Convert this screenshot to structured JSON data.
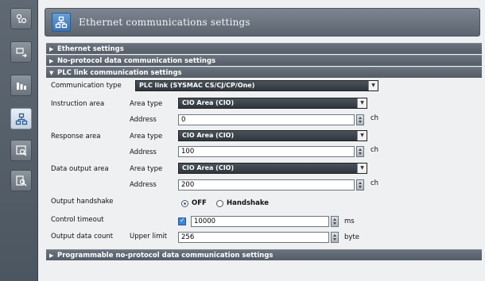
{
  "title": "Ethernet communications settings",
  "sections": {
    "ethernet": "Ethernet settings",
    "no_protocol": "No-protocol data communication settings",
    "plc_link": "PLC link communication settings",
    "programmable": "Programmable no-protocol data communication settings"
  },
  "communication_type": {
    "label": "Communication type",
    "value": "PLC link (SYSMAC CS/CJ/CP/One)"
  },
  "instruction_area": {
    "label": "Instruction area",
    "area_type_label": "Area type",
    "area_type_value": "CIO Area (CIO)",
    "address_label": "Address",
    "address_value": "0",
    "unit": "ch"
  },
  "response_area": {
    "label": "Response area",
    "area_type_label": "Area type",
    "area_type_value": "CIO Area (CIO)",
    "address_label": "Address",
    "address_value": "100",
    "unit": "ch"
  },
  "data_output_area": {
    "label": "Data output area",
    "area_type_label": "Area type",
    "area_type_value": "CIO Area (CIO)",
    "address_label": "Address",
    "address_value": "200",
    "unit": "ch"
  },
  "output_handshake": {
    "label": "Output handshake",
    "off_label": "OFF",
    "handshake_label": "Handshake",
    "selected": "OFF"
  },
  "control_timeout": {
    "label": "Control timeout",
    "value": "10000",
    "unit": "ms"
  },
  "output_data_count": {
    "label": "Output data count",
    "upper_limit_label": "Upper limit",
    "value": "256",
    "unit": "byte"
  },
  "colors": {
    "toolbar": "#545e68",
    "section_header": "#5f6872",
    "active_tool": "#3a74b4",
    "dropdown": "#3a424a"
  }
}
